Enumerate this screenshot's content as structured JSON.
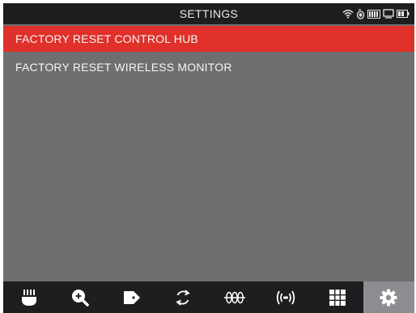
{
  "header": {
    "title": "SETTINGS",
    "status_icons": [
      "wifi-icon",
      "sensor-icon",
      "signal-bars-icon",
      "display-icon",
      "battery-icon"
    ]
  },
  "menu": {
    "items": [
      {
        "label": "FACTORY RESET CONTROL HUB",
        "selected": true
      },
      {
        "label": "FACTORY RESET WIRELESS MONITOR",
        "selected": false
      }
    ]
  },
  "toolbar": {
    "tools": [
      {
        "icon": "tool-icon"
      },
      {
        "icon": "zoom-in-icon"
      },
      {
        "icon": "tag-icon"
      },
      {
        "icon": "refresh-icon"
      },
      {
        "icon": "coil-icon"
      },
      {
        "icon": "wireless-icon"
      },
      {
        "icon": "grid-icon"
      },
      {
        "icon": "gear-icon",
        "active": true
      }
    ]
  },
  "colors": {
    "accent": "#e0302a",
    "background": "#6f6f72",
    "bar": "#1e1e20",
    "active_tool": "#8d8d91"
  }
}
